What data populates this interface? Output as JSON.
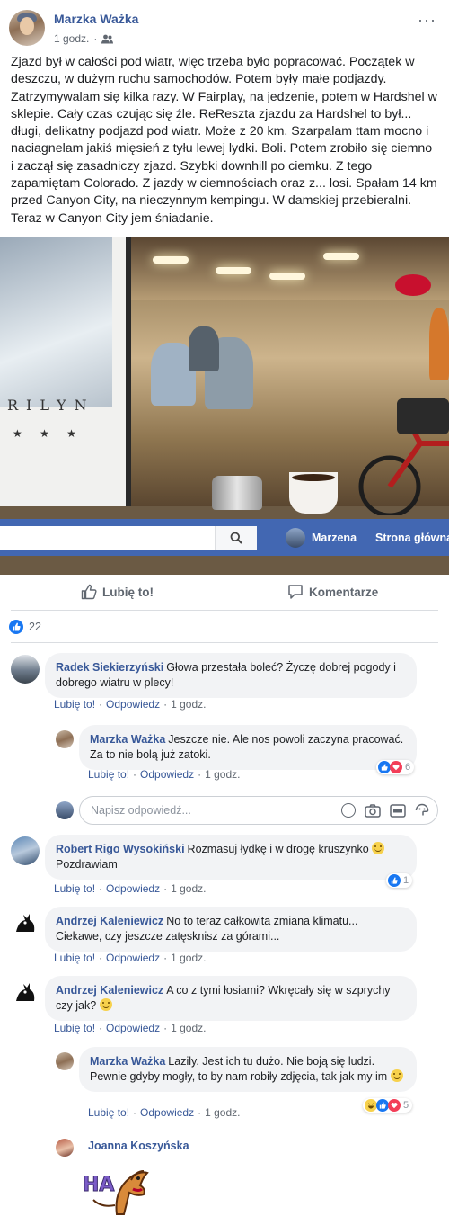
{
  "post": {
    "author": "Marzka Ważka",
    "time": "1 godz.",
    "more": "···",
    "text": "Zjazd był w całości pod wiatr, więc trzeba było popracować. Początek w deszczu, w dużym ruchu samochodów. Potem były małe podjazdy. Zatrzymywalam się kilka razy. W Fairplay, na jedzenie, potem w Hardshel w sklepie. Cały czas czując się źle. ReReszta zjazdu za Hardshel to był... długi, delikatny podjazd pod wiatr. Może z 20 km. Szarpalam ttam mocno i naciagnelam jakiś mięsień z tyłu lewej lydki. Boli. Potem zrobiło się ciemno i zaczął się zasadniczy zjazd. Szybki downhill po ciemku. Z tego zapamiętam Colorado. Z jazdy w ciemnościach oraz z... losi. Spałam 14 km przed Canyon City, na nieczynnym kempingu. W damskiej przebieralni. Teraz w Canyon City jem śniadanie."
  },
  "photo": {
    "poster_text": "RILYN",
    "poster_stars": "★ ★ ★"
  },
  "topbar": {
    "user": "Marzena",
    "home": "Strona główna"
  },
  "actions": {
    "like": "Lubię to!",
    "comment": "Komentarze"
  },
  "reactions_count": "22",
  "labels": {
    "like": "Lubię to!",
    "reply": "Odpowiedz",
    "sep": "·"
  },
  "comments": [
    {
      "name": "Radek Siekierzyński",
      "text": "Głowa przestała boleć? Życzę dobrej pogody i dobrego wiatru w plecy!",
      "time": "1 godz.",
      "replies": [
        {
          "name": "Marzka Ważka",
          "text": "Jeszcze nie. Ale nos powoli zaczyna pracować. Za to nie bolą już zatoki.",
          "time": "1 godz.",
          "reaction_count": "6"
        }
      ]
    },
    {
      "name": "Robert Rigo Wysokiński",
      "text": "Rozmasuj łydkę i w drogę kruszynko",
      "text2": "Pozdrawiam",
      "time": "1 godz.",
      "reaction_count": "1"
    },
    {
      "name": "Andrzej Kaleniewicz",
      "text": "No to teraz całkowita zmiana klimatu... Ciekawe, czy jeszcze zatęsknisz za górami...",
      "time": "1 godz."
    },
    {
      "name": "Andrzej Kaleniewicz",
      "text": "A co z tymi łosiami? Wkręcały się w szprychy czy jak?",
      "time": "1 godz.",
      "replies": [
        {
          "name": "Marzka Ważka",
          "text": "Lazily. Jest ich tu dużo. Nie boją się ludzi. Pewnie gdyby mogły, to by nam robiły zdjęcia, tak jak my im",
          "time": "1 godz.",
          "reaction_count": "5"
        },
        {
          "name": "Joanna Koszyńska",
          "sticker_text": "HA"
        }
      ]
    }
  ],
  "reply_placeholder": "Napisz odpowiedź...",
  "colors": {
    "brand": "#4267b2",
    "link": "#385898",
    "like_blue": "#1877f2",
    "love_red": "#f33e58"
  }
}
